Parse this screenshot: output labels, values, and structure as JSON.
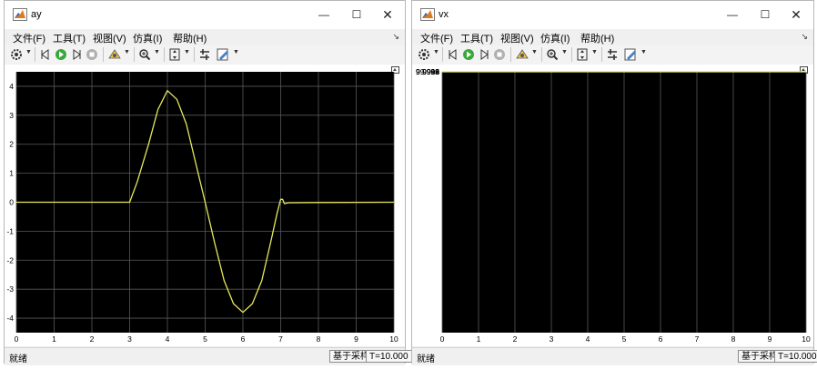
{
  "colors": {
    "axes_bg": "#000000",
    "grid": "#595959",
    "trace": "#e8e85c",
    "window_bg": "#f0f0f0"
  },
  "menu_labels": [
    "文件(F)",
    "工具(T)",
    "视图(V)",
    "仿真(I)",
    "帮助(H)"
  ],
  "toolbar_icons": [
    "gear-icon",
    "step-back-icon",
    "run-icon",
    "step-forward-icon",
    "stop-icon",
    "highlight-icon",
    "zoom-icon",
    "autoscale-icon",
    "cursor-icon",
    "edit-icon"
  ],
  "window_controls": {
    "minimize": "—",
    "maximize": "☐",
    "close": "✕"
  },
  "windows": [
    {
      "title": "ay",
      "status": {
        "left": "就绪",
        "sampling": "基于采样",
        "time": "T=10.000"
      },
      "chart_data": {
        "type": "line",
        "xlim": [
          0,
          10
        ],
        "ylim": [
          -4.5,
          4.5
        ],
        "xticks": [
          "0",
          "1",
          "2",
          "3",
          "4",
          "5",
          "6",
          "7",
          "8",
          "9",
          "10"
        ],
        "yticks": [
          {
            "v": 4,
            "label": "4"
          },
          {
            "v": 3,
            "label": "3"
          },
          {
            "v": 2,
            "label": "2"
          },
          {
            "v": 1,
            "label": "1"
          },
          {
            "v": 0,
            "label": "0"
          },
          {
            "v": -1,
            "label": "-1"
          },
          {
            "v": -2,
            "label": "-2"
          },
          {
            "v": -3,
            "label": "-3"
          },
          {
            "v": -4,
            "label": "-4"
          }
        ],
        "grid": true,
        "series": [
          {
            "x": [
              0,
              3,
              3.2,
              3.5,
              3.75,
              4,
              4.25,
              4.5,
              4.75,
              5,
              5.25,
              5.5,
              5.75,
              6,
              6.25,
              6.5,
              6.75,
              6.9,
              7,
              7.05,
              7.1,
              7.2,
              8,
              10
            ],
            "y": [
              0,
              0,
              0.7,
              2.0,
              3.2,
              3.85,
              3.55,
              2.7,
              1.35,
              0,
              -1.4,
              -2.7,
              -3.5,
              -3.8,
              -3.5,
              -2.7,
              -1.3,
              -0.4,
              0.1,
              0.1,
              -0.05,
              -0.02,
              -0.01,
              0
            ]
          }
        ]
      }
    },
    {
      "title": "vx",
      "status": {
        "left": "就绪",
        "sampling": "基于采样",
        "time": "T=10.000"
      },
      "chart_data": {
        "type": "line",
        "xlim": [
          0,
          10
        ],
        "ylim": [
          0.99986,
          10.00009
        ],
        "xticks": [
          "0",
          "1",
          "2",
          "3",
          "4",
          "5",
          "6",
          "7",
          "8",
          "9",
          "10"
        ],
        "yticks": [
          {
            "v": 10.0,
            "label": "10"
          },
          {
            "v": 9.9998,
            "label": "9.9998"
          },
          {
            "v": 9.9996,
            "label": "9.9996"
          },
          {
            "v": 9.9994,
            "label": "9.9994"
          },
          {
            "v": 9.9992,
            "label": "9.9992"
          },
          {
            "v": 9.999,
            "label": "9.999"
          },
          {
            "v": 9.9988,
            "label": "9.9988"
          }
        ],
        "grid": true,
        "series": [
          {
            "x": [
              0,
              1,
              2,
              3,
              3.2,
              3.5,
              3.8,
              4.1,
              4.4,
              4.7,
              4.85,
              5.0,
              5.3,
              5.6,
              5.8,
              6.0,
              6.3,
              6.6,
              6.85,
              6.95,
              7,
              8,
              9,
              10
            ],
            "y": [
              9.99922,
              9.99927,
              9.99931,
              9.99935,
              9.99921,
              9.99894,
              9.99883,
              9.99898,
              9.9993,
              9.99949,
              9.99951,
              9.99943,
              9.99912,
              9.99894,
              9.99891,
              9.99894,
              9.99925,
              9.99952,
              9.9996,
              9.99958,
              9.99957,
              9.99959,
              9.99962,
              9.99965
            ]
          }
        ]
      }
    }
  ]
}
